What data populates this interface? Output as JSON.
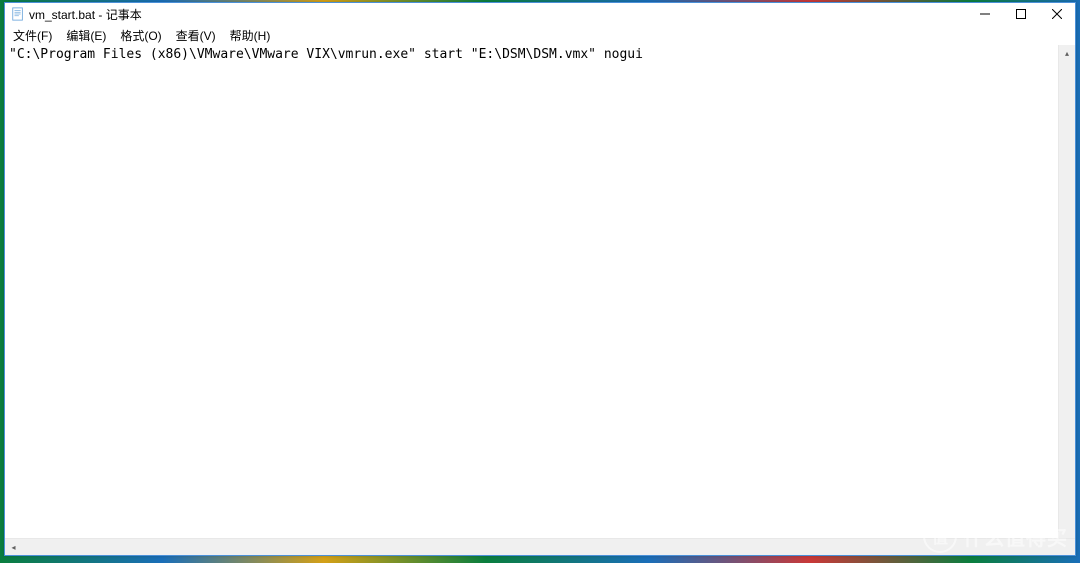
{
  "window": {
    "title": "vm_start.bat - 记事本"
  },
  "menu": {
    "file": "文件(F)",
    "edit": "编辑(E)",
    "format": "格式(O)",
    "view": "查看(V)",
    "help": "帮助(H)"
  },
  "editor": {
    "content": "\"C:\\Program Files (x86)\\VMware\\VMware VIX\\vmrun.exe\" start \"E:\\DSM\\DSM.vmx\" nogui"
  },
  "watermark": {
    "badge": "值",
    "text": "什么值得买"
  }
}
